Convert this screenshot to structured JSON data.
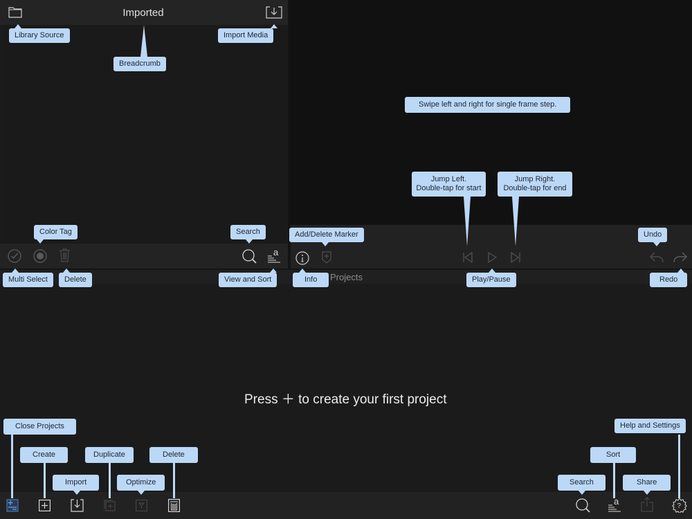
{
  "library": {
    "title": "Imported",
    "icons": {
      "source": "folder-icon",
      "import": "import-tray-icon",
      "multi_select": "checkmark-circle-icon",
      "color_tag": "color-dot-icon",
      "delete": "trash-icon",
      "search": "magnifier-icon",
      "view_sort": "sort-lines-icon"
    }
  },
  "viewer": {
    "icons": {
      "info": "info-circle-icon",
      "marker": "marker-plus-icon",
      "jump_left": "skip-start-icon",
      "play": "play-icon",
      "jump_right": "skip-end-icon",
      "undo": "undo-arrow-icon",
      "redo": "redo-arrow-icon"
    }
  },
  "projects": {
    "header": "Projects",
    "empty_message": "Press ＋ to create your first project",
    "icons": {
      "close_projects": "close-projects-icon",
      "create": "plus-square-icon",
      "import": "import-tray-icon",
      "duplicate": "duplicate-icon",
      "optimize": "optimize-icon",
      "delete": "trash-icon",
      "search": "magnifier-icon",
      "sort": "sort-lines-icon",
      "share": "share-icon",
      "help": "gear-question-icon"
    }
  },
  "tooltips": {
    "library_source": "Library Source",
    "breadcrumb": "Breadcrumb",
    "import_media": "Import Media",
    "color_tag": "Color Tag",
    "search_library": "Search",
    "multi_select": "Multi Select",
    "delete_library": "Delete",
    "view_and_sort": "View and Sort",
    "swipe": "Swipe left and right for single frame step.",
    "jump_left_1": "Jump Left.",
    "jump_left_2": "Double-tap for start",
    "jump_right_1": "Jump Right.",
    "jump_right_2": "Double-tap for end",
    "add_delete_marker": "Add/Delete Marker",
    "undo": "Undo",
    "info": "Info",
    "play_pause": "Play/Pause",
    "redo": "Redo",
    "close_projects": "Close Projects",
    "create": "Create",
    "duplicate": "Duplicate",
    "delete_project": "Delete",
    "import": "Import",
    "optimize": "Optimize",
    "sort": "Sort",
    "help_settings": "Help and Settings",
    "search_projects": "Search",
    "share": "Share"
  },
  "colors": {
    "tooltip_bg": "#bcd8f7",
    "tooltip_text": "#1d2530",
    "accent_blue": "#4a86d8"
  }
}
